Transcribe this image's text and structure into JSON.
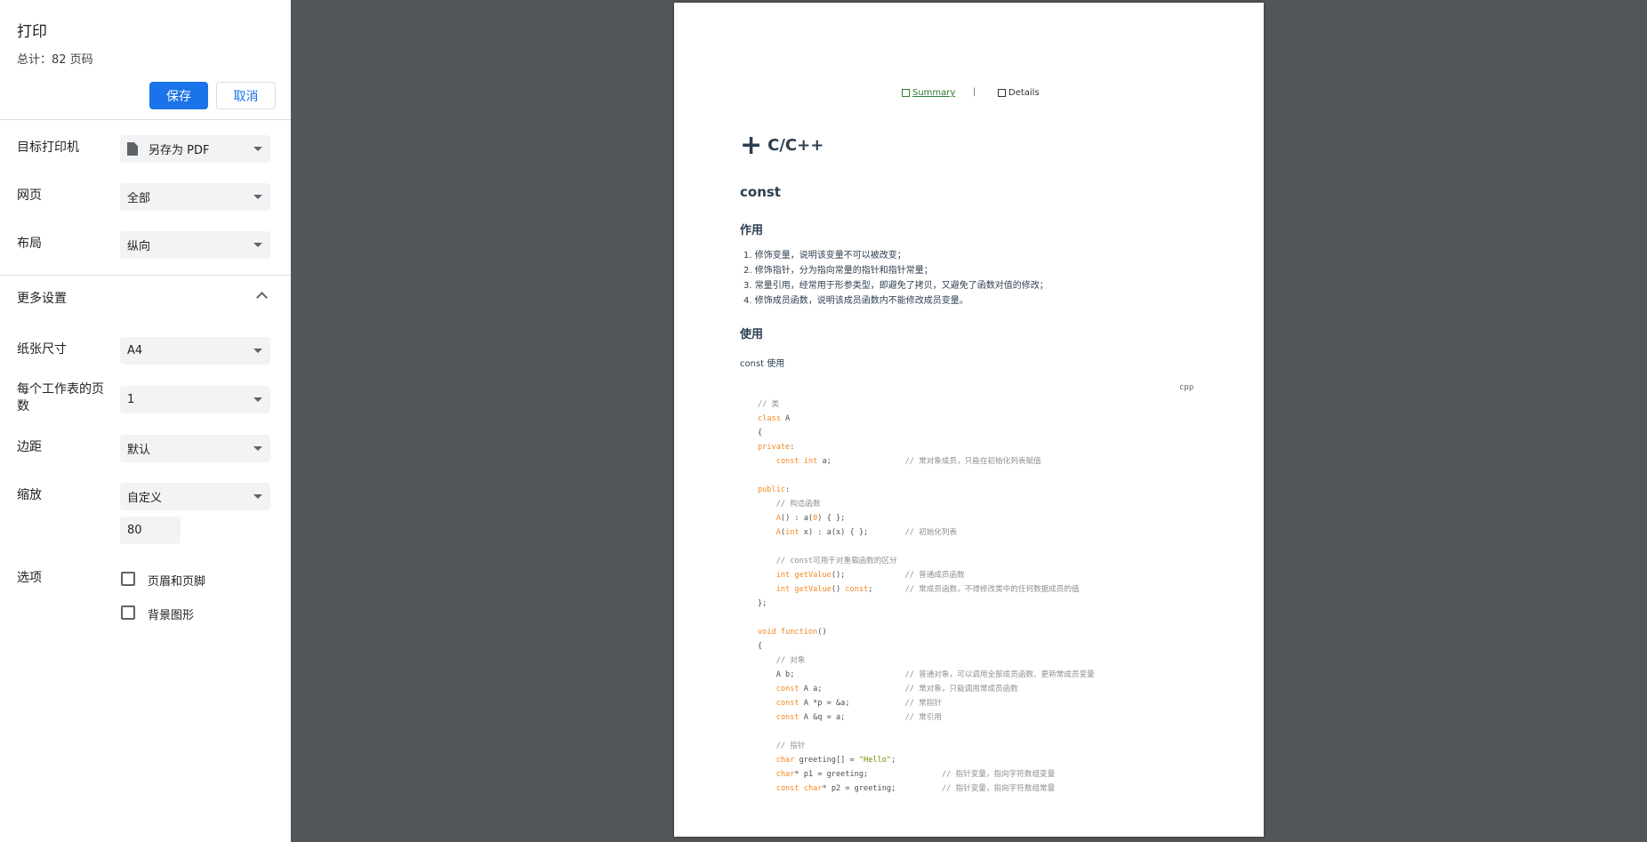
{
  "dialog": {
    "title": "打印",
    "total": "总计：82 页码",
    "save_label": "保存",
    "cancel_label": "取消",
    "destination": {
      "label": "目标打印机",
      "value": "另存为 PDF"
    },
    "pages": {
      "label": "网页",
      "value": "全部"
    },
    "layout": {
      "label": "布局",
      "value": "纵向"
    },
    "more_settings_label": "更多设置",
    "paper_size": {
      "label": "纸张尺寸",
      "value": "A4"
    },
    "pages_per_sheet": {
      "label": "每个工作表的页数",
      "value": "1"
    },
    "margins": {
      "label": "边距",
      "value": "默认"
    },
    "scale": {
      "label": "缩放",
      "value": "自定义",
      "custom_value": "80"
    },
    "options": {
      "label": "选项",
      "headers_footers": {
        "label": "页眉和页脚",
        "checked": false
      },
      "background_graphics": {
        "label": "背景图形",
        "checked": false
      }
    }
  },
  "preview": {
    "nav_summary": "Summary",
    "nav_separator": "|",
    "nav_details": "Details",
    "heading1": "C/C++",
    "heading2": "const",
    "section_purpose": "作用",
    "purpose_items": [
      "修饰变量，说明该变量不可以被改变；",
      "修饰指针，分为指向常量的指针和指针常量；",
      "常量引用，经常用于形参类型，即避免了拷贝，又避免了函数对值的修改；",
      "修饰成员函数，说明该成员函数内不能修改成员变量。"
    ],
    "section_usage": "使用",
    "usage_text": "const 使用",
    "code_lang": "cpp",
    "code_lines": [
      "// 类",
      "class A",
      "{",
      "private:",
      "    const int a;                // 常对象成员，只能在初始化列表赋值",
      "",
      "public:",
      "    // 构造函数",
      "    A() : a(0) { };",
      "    A(int x) : a(x) { };        // 初始化列表",
      "",
      "    // const可用于对重载函数的区分",
      "    int getValue();             // 普通成员函数",
      "    int getValue() const;       // 常成员函数，不得修改类中的任何数据成员的值",
      "};",
      "",
      "void function()",
      "{",
      "    // 对象",
      "    A b;                        // 普通对象，可以调用全部成员函数、更新常成员变量",
      "    const A a;                  // 常对象，只能调用常成员函数",
      "    const A *p = &a;            // 常指针",
      "    const A &q = a;             // 常引用",
      "",
      "    // 指针",
      "    char greeting[] = \"Hello\";",
      "    char* p1 = greeting;                // 指针变量，指向字符数组变量",
      "    const char* p2 = greeting;          // 指针变量，指向字符数组常量"
    ]
  },
  "colors": {
    "accent": "#1a73e8",
    "preview_background": "#525659",
    "keyword": "#f5871f",
    "comment": "#8e908c",
    "string": "#718c00",
    "heading": "#2c3e50"
  }
}
